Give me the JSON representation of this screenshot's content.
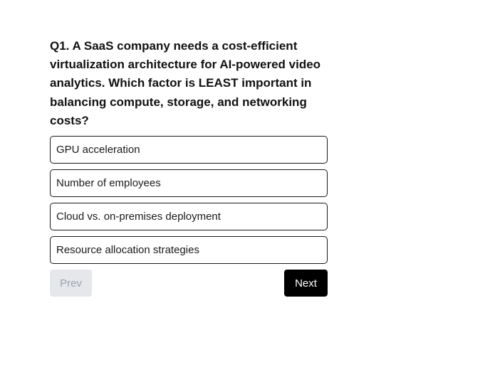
{
  "question": {
    "text": "Q1. A SaaS company needs a cost-efficient\nvirtualization architecture for AI-powered video\nanalytics. Which factor is LEAST important in\nbalancing compute, storage, and networking\ncosts?"
  },
  "options": [
    {
      "label": "GPU acceleration"
    },
    {
      "label": "Number of employees"
    },
    {
      "label": "Cloud vs. on-premises deployment"
    },
    {
      "label": "Resource allocation strategies"
    }
  ],
  "nav": {
    "prev_label": "Prev",
    "next_label": "Next",
    "prev_enabled": false
  },
  "colors": {
    "next_bg": "#000000",
    "prev_bg_disabled": "#e5e7eb",
    "prev_text_disabled": "#9ca3af",
    "option_border": "#1a1a1a"
  }
}
